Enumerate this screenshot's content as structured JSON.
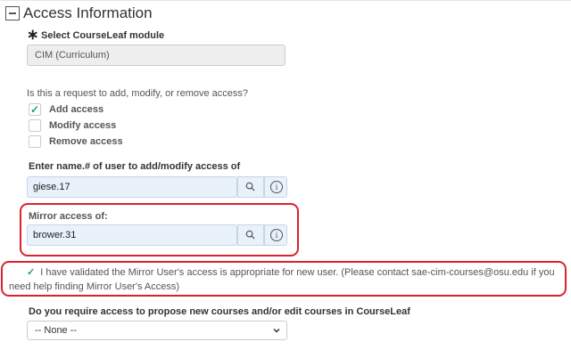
{
  "section": {
    "title": "Access Information"
  },
  "module": {
    "required_mark": "∗",
    "label": "Select CourseLeaf module",
    "value": "CIM (Curriculum)"
  },
  "access_request": {
    "question": "Is this a request to add, modify, or remove access?",
    "options": [
      {
        "label": "Add access",
        "checked": true
      },
      {
        "label": "Modify access",
        "checked": false
      },
      {
        "label": "Remove access",
        "checked": false
      }
    ],
    "check_glyph": "✓"
  },
  "user": {
    "label": "Enter name.# of user to add/modify access of",
    "value": "giese.17"
  },
  "mirror": {
    "label": "Mirror access of:",
    "value": "brower.31"
  },
  "icons": {
    "search": "search-icon",
    "info": "info-icon",
    "info_glyph": "i",
    "highlight_color": "#d9232d",
    "check_color": "#2a9d6b"
  },
  "validation": {
    "check_glyph": "✓",
    "text": "I have validated the Mirror User's access is appropriate for new user. (Please contact sae-cim-courses@osu.edu if you need help finding Mirror User's Access)"
  },
  "courses": {
    "question": "Do you require access to propose new courses and/or edit courses in CourseLeaf",
    "selected": "-- None --"
  }
}
